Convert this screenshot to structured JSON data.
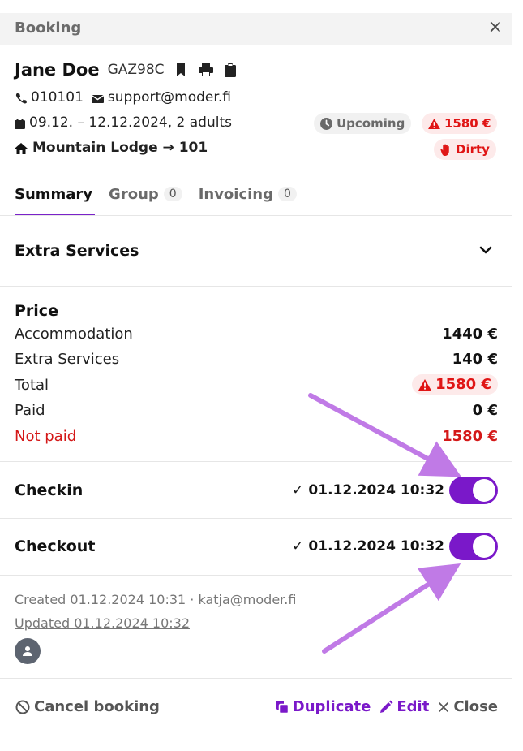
{
  "header": {
    "title": "Booking",
    "close_glyph": "×"
  },
  "guest": {
    "name": "Jane Doe",
    "code": "GAZ98C",
    "icons": [
      "bookmark-icon",
      "print-icon",
      "clipboard-icon"
    ],
    "phone": "010101",
    "email": "support@moder.fi",
    "dates": "09.12. – 12.12.2024, 2 adults",
    "room": "Mountain Lodge → 101"
  },
  "badges": {
    "status": "Upcoming",
    "amount": "1580 €",
    "housekeeping": "Dirty"
  },
  "tabs": [
    {
      "label": "Summary",
      "count": null,
      "active": true
    },
    {
      "label": "Group",
      "count": "0",
      "active": false
    },
    {
      "label": "Invoicing",
      "count": "0",
      "active": false
    }
  ],
  "extra_services": {
    "title": "Extra Services"
  },
  "price": {
    "title": "Price",
    "rows": [
      {
        "label": "Accommodation",
        "value": "1440 €"
      },
      {
        "label": "Extra Services",
        "value": "140 €"
      },
      {
        "label": "Total",
        "value": "1580 €"
      },
      {
        "label": "Paid",
        "value": "0 €"
      },
      {
        "label": "Not paid",
        "value": "1580 €"
      }
    ]
  },
  "checkin": {
    "label": "Checkin",
    "check": "✓",
    "datetime": "01.12.2024 10:32",
    "enabled": true
  },
  "checkout": {
    "label": "Checkout",
    "check": "✓",
    "datetime": "01.12.2024 10:32",
    "enabled": true
  },
  "meta": {
    "created": "Created 01.12.2024 10:31 · katja@moder.fi",
    "updated": "Updated 01.12.2024 10:32"
  },
  "footer": {
    "cancel": "Cancel booking",
    "duplicate": "Duplicate",
    "edit": "Edit",
    "close": "Close"
  },
  "colors": {
    "accent": "#7a18c9",
    "danger": "#e01515",
    "annotation_arrow": "#c07ae6"
  }
}
